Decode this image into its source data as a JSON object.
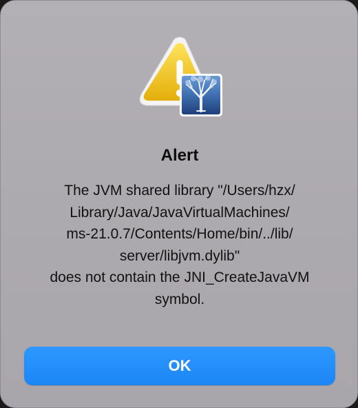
{
  "dialog": {
    "title": "Alert",
    "message_lines": [
      "The JVM shared library \"/Users/hzx/",
      "Library/Java/JavaVirtualMachines/",
      "ms-21.0.7/Contents/Home/bin/../lib/",
      "server/libjvm.dylib\"",
      "does not contain the JNI_CreateJavaVM",
      "symbol."
    ],
    "ok_label": "OK",
    "icons": {
      "main": "warning-triangle-icon",
      "badge": "app-tree-icon"
    },
    "colors": {
      "accent": "#1f8cfa",
      "warning": "#f1c40f"
    }
  }
}
